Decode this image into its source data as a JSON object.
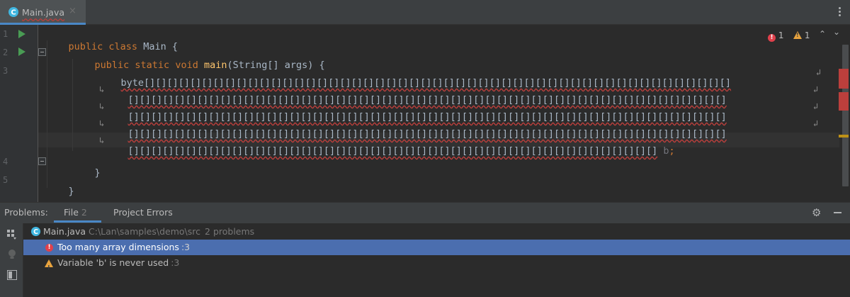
{
  "colors": {
    "keyword": "#cc7832",
    "method": "#ffc66d",
    "error": "#e0404b",
    "warning": "#e8a33e",
    "selection": "#4b6eaf",
    "run": "#499c54"
  },
  "tab": {
    "icon": "java-class-icon",
    "label": "Main.java",
    "close": "×"
  },
  "gutter": {
    "line_numbers": [
      "1",
      "2",
      "3",
      "4",
      "5"
    ]
  },
  "code": {
    "line1": {
      "kw1": "public ",
      "kw2": "class ",
      "name": "Main ",
      "brace": "{"
    },
    "line2": {
      "kw1": "public ",
      "kw2": "static ",
      "kw3": "void ",
      "method": "main",
      "params": "(String[] args) {"
    },
    "line3a": "byte[][][][][][][][][][][][][][][][][][][][][][][][][][][][][][][][][][][][][][][][][][][][][][][][][][][]",
    "line3b": "[][][][][][][][][][][][][][][][][][][][][][][][][][][][][][][][][][][][][][][][][][][][][][][][][][][][]",
    "line3c": "[][][][][][][][][][][][][][][][][][][][][][][][][][][][][][][][][][][][][][][][][][][][][][][][][][][][]",
    "line3d": "[][][][][][][][][][][][][][][][][][][][][][][][][][][][][][][][][][][][][][][][][][][][][][][][][][][][]",
    "line3e": "[][][][][][][][][][][][][][][][][][][][][][][][][][][][][][][][][][][][][][][][][][][][][][]",
    "var": " b",
    "semicolon": ";",
    "line4": "}",
    "line5": "}"
  },
  "inspections": {
    "errors": "1",
    "warnings": "1",
    "up": "⌃",
    "down": "⌄"
  },
  "problems": {
    "title": "Problems:",
    "tabs": [
      {
        "label": "File",
        "count": "2"
      },
      {
        "label": "Project Errors",
        "count": ""
      }
    ],
    "file": {
      "name": "Main.java",
      "path": "C:\\Lan\\samples\\demo\\src",
      "count": "2 problems"
    },
    "items": [
      {
        "severity": "error",
        "text": "Too many array dimensions",
        "loc": ":3"
      },
      {
        "severity": "warning",
        "text": "Variable 'b' is never used",
        "loc": ":3"
      }
    ]
  }
}
